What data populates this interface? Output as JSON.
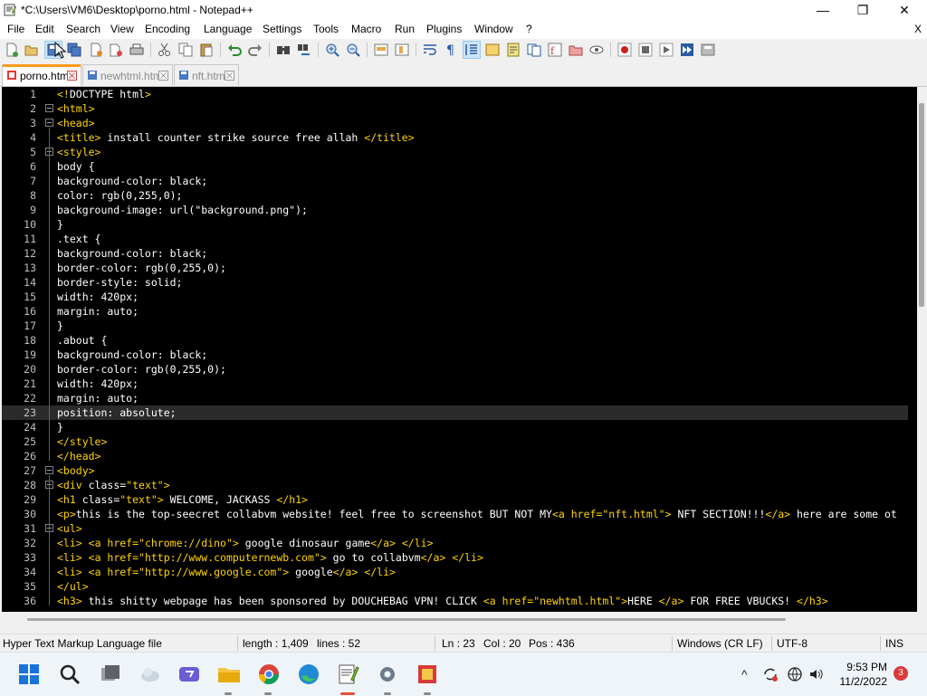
{
  "window": {
    "title": "*C:\\Users\\VM6\\Desktop\\porno.html - Notepad++",
    "minimize_glyph": "—",
    "maximize_glyph": "❐",
    "close_glyph": "✕"
  },
  "menu": {
    "items": [
      "File",
      "Edit",
      "Search",
      "View",
      "Encoding",
      "Language",
      "Settings",
      "Tools",
      "Macro",
      "Run",
      "Plugins",
      "Window",
      "?"
    ],
    "close_glyph": "X"
  },
  "toolbar": {
    "icons": [
      "new-file-icon",
      "open-file-icon",
      "save-icon",
      "save-all-icon",
      "close-icon",
      "close-all-icon",
      "print-icon",
      "cut-icon",
      "copy-icon",
      "paste-icon",
      "undo-icon",
      "redo-icon",
      "find-icon",
      "replace-icon",
      "zoom-in-icon",
      "zoom-out-icon",
      "sync-vertical-icon",
      "sync-horizontal-icon",
      "word-wrap-icon",
      "show-all-chars-icon",
      "indent-guide-icon",
      "user-defined-language-icon",
      "document-map-icon",
      "document-list-icon",
      "function-list-icon",
      "folder-as-workspace-icon",
      "monitoring-icon",
      "record-macro-icon",
      "stop-macro-icon",
      "play-macro-icon",
      "run-macro-multiple-icon",
      "save-macro-icon"
    ]
  },
  "tabs": [
    {
      "label": "porno.html",
      "active": true
    },
    {
      "label": "newhtml.html",
      "active": false
    },
    {
      "label": "nft.html",
      "active": false
    }
  ],
  "editor": {
    "current_line": 23,
    "lines": [
      {
        "n": "1",
        "segs": [
          [
            "tag",
            "<!"
          ],
          [
            "txt",
            "DOCTYPE html"
          ],
          [
            "tag",
            ">"
          ]
        ]
      },
      {
        "n": "2",
        "segs": [
          [
            "tag",
            "<html>"
          ]
        ]
      },
      {
        "n": "3",
        "segs": [
          [
            "tag",
            "<head>"
          ]
        ]
      },
      {
        "n": "4",
        "segs": [
          [
            "tag",
            "<title>"
          ],
          [
            "txt",
            " install counter strike source free allah "
          ],
          [
            "tag",
            "</title>"
          ]
        ]
      },
      {
        "n": "5",
        "segs": [
          [
            "tag",
            "<style>"
          ]
        ]
      },
      {
        "n": "6",
        "segs": [
          [
            "txt",
            "body {"
          ]
        ]
      },
      {
        "n": "7",
        "segs": [
          [
            "txt",
            "background-color: black;"
          ]
        ]
      },
      {
        "n": "8",
        "segs": [
          [
            "txt",
            "color: rgb(0,255,0);"
          ]
        ]
      },
      {
        "n": "9",
        "segs": [
          [
            "txt",
            "background-image: url(\"background.png\");"
          ]
        ]
      },
      {
        "n": "10",
        "segs": [
          [
            "txt",
            "}"
          ]
        ]
      },
      {
        "n": "11",
        "segs": [
          [
            "txt",
            ".text {"
          ]
        ]
      },
      {
        "n": "12",
        "segs": [
          [
            "txt",
            "background-color: black;"
          ]
        ]
      },
      {
        "n": "13",
        "segs": [
          [
            "txt",
            "border-color: rgb(0,255,0);"
          ]
        ]
      },
      {
        "n": "14",
        "segs": [
          [
            "txt",
            "border-style: solid;"
          ]
        ]
      },
      {
        "n": "15",
        "segs": [
          [
            "txt",
            "width: 420px;"
          ]
        ]
      },
      {
        "n": "16",
        "segs": [
          [
            "txt",
            "margin: auto;"
          ]
        ]
      },
      {
        "n": "17",
        "segs": [
          [
            "txt",
            "}"
          ]
        ]
      },
      {
        "n": "18",
        "segs": [
          [
            "txt",
            ".about {"
          ]
        ]
      },
      {
        "n": "19",
        "segs": [
          [
            "txt",
            "background-color: black;"
          ]
        ]
      },
      {
        "n": "20",
        "segs": [
          [
            "txt",
            "border-color: rgb(0,255,0);"
          ]
        ]
      },
      {
        "n": "21",
        "segs": [
          [
            "txt",
            "width: 420px;"
          ]
        ]
      },
      {
        "n": "22",
        "segs": [
          [
            "txt",
            "margin: auto;"
          ]
        ]
      },
      {
        "n": "23",
        "segs": [
          [
            "txt",
            "position: absolute;"
          ]
        ]
      },
      {
        "n": "24",
        "segs": [
          [
            "txt",
            "}"
          ]
        ]
      },
      {
        "n": "25",
        "segs": [
          [
            "tag",
            "</style>"
          ]
        ]
      },
      {
        "n": "26",
        "segs": [
          [
            "tag",
            "</head>"
          ]
        ]
      },
      {
        "n": "27",
        "segs": [
          [
            "tag",
            "<body>"
          ]
        ]
      },
      {
        "n": "28",
        "segs": [
          [
            "tag",
            "<div "
          ],
          [
            "txt",
            "class="
          ],
          [
            "tag",
            "\"text\">"
          ]
        ]
      },
      {
        "n": "29",
        "segs": [
          [
            "tag",
            "<h1 "
          ],
          [
            "txt",
            "class="
          ],
          [
            "tag",
            "\"text\">"
          ],
          [
            "txt",
            " WELCOME, JACKASS "
          ],
          [
            "tag",
            "</h1>"
          ]
        ]
      },
      {
        "n": "30",
        "segs": [
          [
            "tag",
            "<p>"
          ],
          [
            "txt",
            "this is the top-seecret collabvm website! feel free to screenshot BUT NOT MY"
          ],
          [
            "tag",
            "<a href="
          ],
          [
            "tag",
            "\"nft.html\">"
          ],
          [
            "txt",
            " NFT SECTION!!!"
          ],
          [
            "tag",
            "</a>"
          ],
          [
            "txt",
            " here are some ot"
          ]
        ]
      },
      {
        "n": "31",
        "segs": [
          [
            "tag",
            "<ul>"
          ]
        ]
      },
      {
        "n": "32",
        "segs": [
          [
            "tag",
            "<li>"
          ],
          [
            "txt",
            " "
          ],
          [
            "tag",
            "<a href=\""
          ],
          [
            "tag",
            "chrome://dino"
          ],
          [
            "tag",
            "\">"
          ],
          [
            "txt",
            " google dinosaur game"
          ],
          [
            "tag",
            "</a>"
          ],
          [
            "txt",
            " "
          ],
          [
            "tag",
            "</li>"
          ]
        ]
      },
      {
        "n": "33",
        "segs": [
          [
            "tag",
            "<li>"
          ],
          [
            "txt",
            " "
          ],
          [
            "tag",
            "<a href=\""
          ],
          [
            "tag",
            "http://www.computernewb.com"
          ],
          [
            "tag",
            "\">"
          ],
          [
            "txt",
            " go to collabvm"
          ],
          [
            "tag",
            "</a>"
          ],
          [
            "txt",
            " "
          ],
          [
            "tag",
            "</li>"
          ]
        ]
      },
      {
        "n": "34",
        "segs": [
          [
            "tag",
            "<li>"
          ],
          [
            "txt",
            " "
          ],
          [
            "tag",
            "<a href=\""
          ],
          [
            "tag",
            "http://www.google.com"
          ],
          [
            "tag",
            "\">"
          ],
          [
            "txt",
            " google"
          ],
          [
            "tag",
            "</a>"
          ],
          [
            "txt",
            " "
          ],
          [
            "tag",
            "</li>"
          ]
        ]
      },
      {
        "n": "35",
        "segs": [
          [
            "tag",
            "</ul>"
          ]
        ]
      },
      {
        "n": "36",
        "segs": [
          [
            "tag",
            "<h3>"
          ],
          [
            "txt",
            " this shitty webpage has been sponsored by DOUCHEBAG VPN! CLICK "
          ],
          [
            "tag",
            "<a href="
          ],
          [
            "tag",
            "\"newhtml.html\">"
          ],
          [
            "txt",
            "HERE "
          ],
          [
            "tag",
            "</a>"
          ],
          [
            "txt",
            " FOR FREE VBUCKS! "
          ],
          [
            "tag",
            "</h3>"
          ]
        ]
      }
    ]
  },
  "status": {
    "file_type": "Hyper Text Markup Language file",
    "length": "length : 1,409",
    "lines": "lines : 52",
    "ln": "Ln : 23",
    "col": "Col : 20",
    "pos": "Pos : 436",
    "eol": "Windows (CR LF)",
    "encoding": "UTF-8",
    "mode": "INS"
  },
  "taskbar": {
    "apps": [
      "start-icon",
      "search-icon",
      "task-view-icon",
      "weather-icon",
      "teams-icon",
      "file-explorer-icon",
      "chrome-icon",
      "edge-icon",
      "notepadpp-icon",
      "settings-icon",
      "media-icon"
    ],
    "time": "9:53 PM",
    "date": "11/2/2022",
    "notification_count": "3"
  },
  "colors": {
    "tag": "#ffd400",
    "text": "#ffffff",
    "editor_bg": "#000000",
    "active_tab_accent": "#fa9c1c"
  }
}
